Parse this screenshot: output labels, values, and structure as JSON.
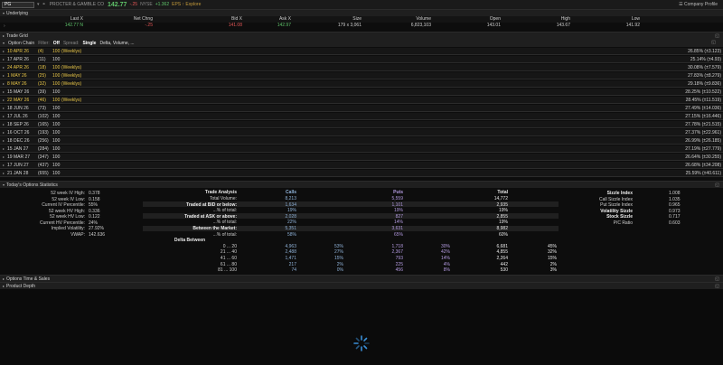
{
  "topbar": {
    "symbol": "PG",
    "company": "PROCTER & GAMBLE CO",
    "last": "142.77",
    "change": "-.25",
    "exchange": "NYSE",
    "change2": "+1.362",
    "extra": "EPS ↑ Explore",
    "profile": "Company Profile"
  },
  "underlying": {
    "title": "Underlying",
    "headers": [
      "Last X",
      "Net Chng",
      "Bid X",
      "Ask X",
      "Size",
      "Volume",
      "Open",
      "High",
      "Low"
    ],
    "values": [
      "142.77 N",
      "-.25",
      "141.08",
      "142.97",
      "179 x 3,061",
      "6,823,103",
      "143.01",
      "143.67",
      "141.92"
    ]
  },
  "trade_grid": {
    "title": "Trade Grid"
  },
  "option_chain": {
    "title": "Option Chain",
    "filter_label": "Filter:",
    "filter_value": "Off",
    "spread_label": "Spread:",
    "spread_value": "Single",
    "layout_value": "Delta, Volume, ...",
    "rows": [
      {
        "exp": "10 APR 26",
        "days": "(4)",
        "mult": "100",
        "weekly": "(Weeklys)",
        "iv": "26.85% (±3.123)"
      },
      {
        "exp": "17 APR 26",
        "days": "(11)",
        "mult": "100",
        "weekly": "",
        "iv": "25.14% (±4.93)"
      },
      {
        "exp": "24 APR 26",
        "days": "(18)",
        "mult": "100",
        "weekly": "(Weeklys)",
        "iv": "30.08% (±7.579)"
      },
      {
        "exp": "1 MAY 26",
        "days": "(25)",
        "mult": "100",
        "weekly": "(Weeklys)",
        "iv": "27.83% (±8.279)"
      },
      {
        "exp": "8 MAY 26",
        "days": "(32)",
        "mult": "100",
        "weekly": "(Weeklys)",
        "iv": "29.18% (±9.836)"
      },
      {
        "exp": "15 MAY 26",
        "days": "(39)",
        "mult": "100",
        "weekly": "",
        "iv": "28.25% (±10.522)"
      },
      {
        "exp": "22 MAY 26",
        "days": "(46)",
        "mult": "100",
        "weekly": "(Weeklys)",
        "iv": "28.45% (±11.519)"
      },
      {
        "exp": "18 JUN 26",
        "days": "(73)",
        "mult": "100",
        "weekly": "",
        "iv": "27.49% (±14.036)"
      },
      {
        "exp": "17 JUL 26",
        "days": "(102)",
        "mult": "100",
        "weekly": "",
        "iv": "27.15% (±16.446)"
      },
      {
        "exp": "18 SEP 26",
        "days": "(165)",
        "mult": "100",
        "weekly": "",
        "iv": "27.78% (±21.515)"
      },
      {
        "exp": "16 OCT 26",
        "days": "(193)",
        "mult": "100",
        "weekly": "",
        "iv": "27.37% (±22.961)"
      },
      {
        "exp": "18 DEC 26",
        "days": "(256)",
        "mult": "100",
        "weekly": "",
        "iv": "26.99% (±26.185)"
      },
      {
        "exp": "15 JAN 27",
        "days": "(284)",
        "mult": "100",
        "weekly": "",
        "iv": "27.19% (±27.779)"
      },
      {
        "exp": "19 MAR 27",
        "days": "(347)",
        "mult": "100",
        "weekly": "",
        "iv": "26.64% (±30.255)"
      },
      {
        "exp": "17 JUN 27",
        "days": "(437)",
        "mult": "100",
        "weekly": "",
        "iv": "26.68% (±34.208)"
      },
      {
        "exp": "21 JAN 28",
        "days": "(655)",
        "mult": "100",
        "weekly": "",
        "iv": "25.59% (±40.611)"
      }
    ]
  },
  "stats": {
    "title": "Today's Options Statistics",
    "left": [
      {
        "label": "52 week IV High:",
        "value": "0.378"
      },
      {
        "label": "52 week IV Low:",
        "value": "0.158"
      },
      {
        "label": "Current IV Percentile:",
        "value": "55%"
      },
      {
        "label": "52 week HV High:",
        "value": "0.336"
      },
      {
        "label": "52 week HV Low:",
        "value": "0.122"
      },
      {
        "label": "Current HV Percentile:",
        "value": "24%"
      },
      {
        "label": "Implied Volatility:",
        "value": "27.92%"
      },
      {
        "label": "VWAP:",
        "value": "142.636"
      }
    ],
    "trade_analysis": {
      "header": "Trade Analysis",
      "calls": "Calls",
      "puts": "Puts",
      "total": "Total",
      "rows": [
        {
          "label": "Total Volume:",
          "calls": "8,213",
          "cp": "",
          "puts": "5,559",
          "pp": "",
          "total": "14,772",
          "tp": "",
          "hl": false
        },
        {
          "label": "Traded at BID or below:",
          "calls": "1,634",
          "cp": "",
          "puts": "1,101",
          "pp": "",
          "total": "2,935",
          "tp": "",
          "hl": true
        },
        {
          "label": "...% of total:",
          "calls": "19%",
          "cp": "",
          "puts": "19%",
          "pp": "",
          "total": "19%",
          "tp": "",
          "hl": false
        },
        {
          "label": "Traded at ASK or above:",
          "calls": "2,028",
          "cp": "",
          "puts": "827",
          "pp": "",
          "total": "2,855",
          "tp": "",
          "hl": true
        },
        {
          "label": "...% of total:",
          "calls": "22%",
          "cp": "",
          "puts": "14%",
          "pp": "",
          "total": "19%",
          "tp": "",
          "hl": false
        },
        {
          "label": "Between the Market:",
          "calls": "5,351",
          "cp": "",
          "puts": "3,631",
          "pp": "",
          "total": "8,982",
          "tp": "",
          "hl": true
        },
        {
          "label": "...% of total:",
          "calls": "58%",
          "cp": "",
          "puts": "65%",
          "pp": "",
          "total": "60%",
          "tp": "",
          "hl": false
        }
      ],
      "delta_header": "Delta Between",
      "delta_rows": [
        {
          "label": "0 ... 20",
          "calls": "4,963",
          "cp": "53%",
          "puts": "1,718",
          "pp": "30%",
          "total": "6,681",
          "tp": "45%"
        },
        {
          "label": "21 ... 40",
          "calls": "2,488",
          "cp": "27%",
          "puts": "2,367",
          "pp": "42%",
          "total": "4,855",
          "tp": "32%"
        },
        {
          "label": "41 ... 60",
          "calls": "1,471",
          "cp": "15%",
          "puts": "793",
          "pp": "14%",
          "total": "2,264",
          "tp": "15%"
        },
        {
          "label": "61 ... 80",
          "calls": "217",
          "cp": "2%",
          "puts": "225",
          "pp": "4%",
          "total": "442",
          "tp": "2%"
        },
        {
          "label": "81 ... 100",
          "calls": "74",
          "cp": "0%",
          "puts": "456",
          "pp": "8%",
          "total": "530",
          "tp": "3%"
        }
      ]
    },
    "right": [
      {
        "label": "Sizzle Index",
        "value": "1.008"
      },
      {
        "label": "Call Sizzle Index",
        "value": "1.035"
      },
      {
        "label": "Put Sizzle Index",
        "value": "0.965"
      },
      {
        "label": "Volatility Sizzle",
        "value": "0.973"
      },
      {
        "label": "Stock Sizzle",
        "value": "0.717"
      },
      {
        "label": "P/C Ratio",
        "value": "0.603"
      }
    ]
  },
  "options_time_sales": {
    "title": "Options Time & Sales"
  },
  "product_depth": {
    "title": "Product Depth"
  }
}
